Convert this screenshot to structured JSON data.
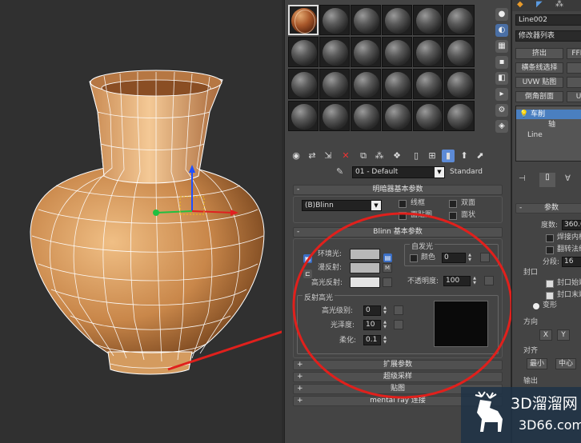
{
  "material_editor": {
    "material_name": "01 - Default",
    "material_type": "Standard",
    "shader_rollout": {
      "title": "明暗器基本参数",
      "shader": "(B)Blinn",
      "wire": "线框",
      "two_sided": "双面",
      "face_map": "面贴图",
      "faceted": "面状"
    },
    "blinn_rollout": {
      "title": "Blinn 基本参数",
      "ambient": "环境光:",
      "diffuse": "漫反射:",
      "specular": "高光反射:",
      "self_illum": "自发光",
      "color": "颜色",
      "self_illum_value": "0",
      "opacity": "不透明度:",
      "opacity_value": "100",
      "specular_highlights": "反射高光",
      "specular_level": "高光级别:",
      "specular_level_value": "0",
      "glossiness": "光泽度:",
      "glossiness_value": "10",
      "soften": "柔化:",
      "soften_value": "0.1",
      "map_button": "M"
    },
    "rollouts": [
      "扩展参数",
      "超级采样",
      "贴图",
      "mental ray 连接"
    ],
    "plus": "+",
    "minus": "-"
  },
  "command_panel": {
    "object_name": "Line002",
    "modifier_list": "修改器列表",
    "buttons": [
      "挤出",
      "FFD",
      "横条线选择",
      "",
      "UVW 贴图",
      "",
      "倒角剖面",
      "U"
    ],
    "stack": [
      "车削",
      "轴",
      "Line"
    ],
    "params_title": "参数",
    "degrees_label": "度数:",
    "degrees_value": "360.0",
    "weld_core": "焊接内核",
    "flip_normals": "翻转法线",
    "segments_label": "分段:",
    "segments_value": "16",
    "capping": "封口",
    "cap_start": "封口始端",
    "cap_end": "封口末端",
    "morph": "变形",
    "direction": "方向",
    "dir_x": "X",
    "dir_y": "Y",
    "align": "对齐",
    "align_min": "最小",
    "align_center": "中心",
    "output": "输出"
  },
  "watermark": {
    "logo": "3D溜溜网",
    "url": "3D66.com"
  },
  "colors": {
    "accent": "#4a7fc0",
    "annotation": "#e0201c",
    "vase": "#d49b5f"
  }
}
